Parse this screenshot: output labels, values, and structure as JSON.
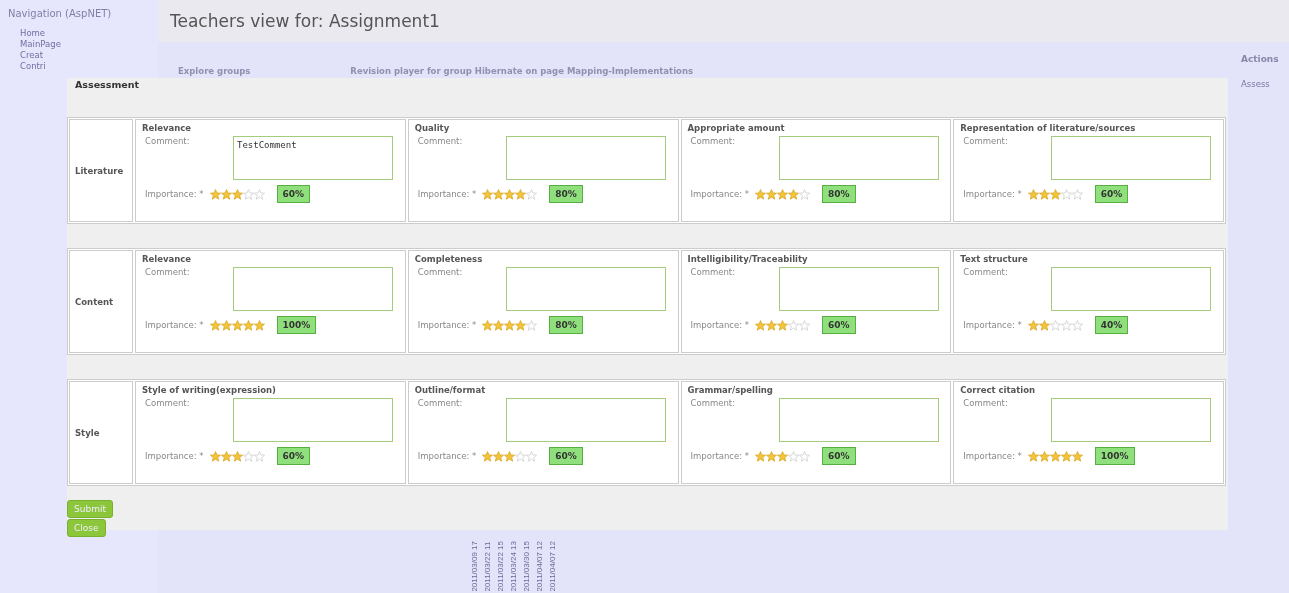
{
  "navigation": {
    "title": "Navigation (AspNET)",
    "items": [
      "Home",
      "MainPage",
      "Creat",
      "Contri"
    ]
  },
  "page_title": "Teachers view for: Assignment1",
  "links": [
    "Explore groups",
    "Revision player for group Hibernate on page Mapping-Implementations"
  ],
  "actions": {
    "title": "Actions",
    "items": [
      "Assess"
    ]
  },
  "timestamps": [
    "2011/03/09 17",
    "2011/03/22 11",
    "2011/03/22 15",
    "2011/03/24 13",
    "2011/03/30 15",
    "2011/04/07 12",
    "2011/04/07 12"
  ],
  "dialog": {
    "title": "Assessment",
    "sections": [
      {
        "name": "Literature",
        "criteria": [
          {
            "title": "Relevance",
            "comment_label": "Comment:",
            "comment": "TestComment",
            "importance_label": "Importance: *",
            "stars": 3,
            "percent": "60%"
          },
          {
            "title": "Quality",
            "comment_label": "Comment:",
            "importance_label": "Importance: *",
            "stars": 4,
            "percent": "80%"
          },
          {
            "title": "Appropriate amount",
            "comment_label": "Comment:",
            "importance_label": "Importance: *",
            "stars": 4,
            "percent": "80%"
          },
          {
            "title": "Representation of literature/sources",
            "comment_label": "Comment:",
            "importance_label": "Importance: *",
            "stars": 3,
            "percent": "60%"
          }
        ]
      },
      {
        "name": "Content",
        "criteria": [
          {
            "title": "Relevance",
            "comment_label": "Comment:",
            "importance_label": "Importance: *",
            "stars": 5,
            "percent": "100%"
          },
          {
            "title": "Completeness",
            "comment_label": "Comment:",
            "importance_label": "Importance: *",
            "stars": 4,
            "percent": "80%"
          },
          {
            "title": "Intelligibility/Traceability",
            "comment_label": "Comment:",
            "importance_label": "Importance: *",
            "stars": 3,
            "percent": "60%"
          },
          {
            "title": "Text structure",
            "comment_label": "Comment:",
            "importance_label": "Importance: *",
            "stars": 2,
            "percent": "40%"
          }
        ]
      },
      {
        "name": "Style",
        "criteria": [
          {
            "title": "Style of writing(expression)",
            "comment_label": "Comment:",
            "importance_label": "Importance: *",
            "stars": 3,
            "percent": "60%"
          },
          {
            "title": "Outline/format",
            "comment_label": "Comment:",
            "importance_label": "Importance: *",
            "stars": 3,
            "percent": "60%"
          },
          {
            "title": "Grammar/spelling",
            "comment_label": "Comment:",
            "importance_label": "Importance: *",
            "stars": 3,
            "percent": "60%"
          },
          {
            "title": "Correct citation",
            "comment_label": "Comment:",
            "importance_label": "Importance: *",
            "stars": 5,
            "percent": "100%"
          }
        ]
      }
    ],
    "buttons": [
      "Submit",
      "Close"
    ]
  }
}
